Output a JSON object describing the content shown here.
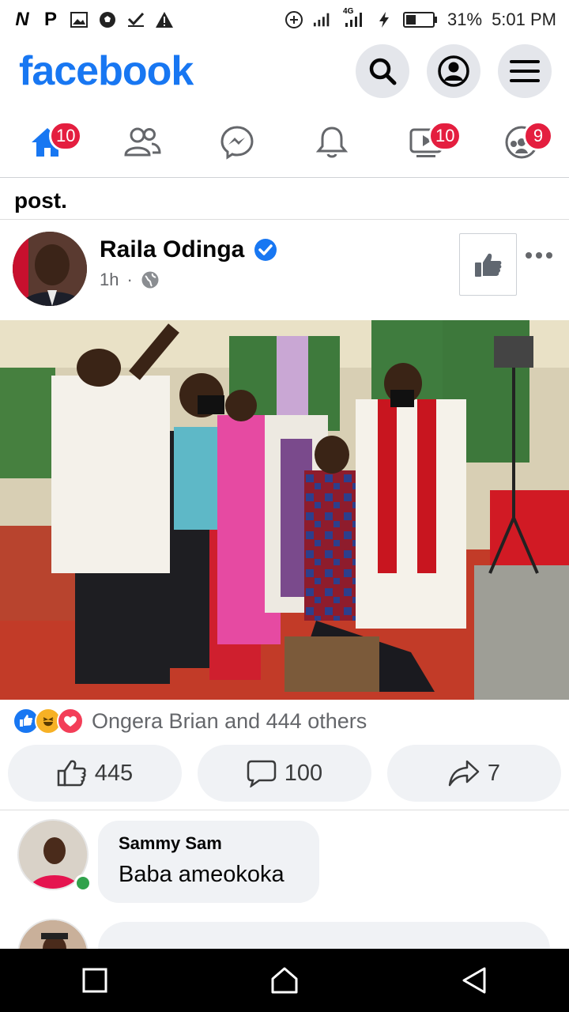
{
  "status_bar": {
    "left_icons": [
      "n-letter-icon",
      "p-letter-icon",
      "gallery-icon",
      "soccer-icon",
      "check-icon",
      "warning-icon"
    ],
    "network": "4G",
    "battery": "31%",
    "time": "5:01 PM"
  },
  "header": {
    "logo": "facebook"
  },
  "nav": {
    "home_badge": "10",
    "video_badge": "10",
    "groups_badge": "9"
  },
  "previous_post": {
    "tail_text": "post."
  },
  "post": {
    "author": "Raila Odinga",
    "time": "1h",
    "reactions_text": "Ongera Brian and 444 others",
    "like_count": "445",
    "comment_count": "100",
    "share_count": "7"
  },
  "comments": [
    {
      "name": "Sammy Sam",
      "text": "Baba ameokoka"
    }
  ],
  "colors": {
    "brand": "#1877f2",
    "badge": "#e41e3f",
    "online": "#31a24c"
  }
}
